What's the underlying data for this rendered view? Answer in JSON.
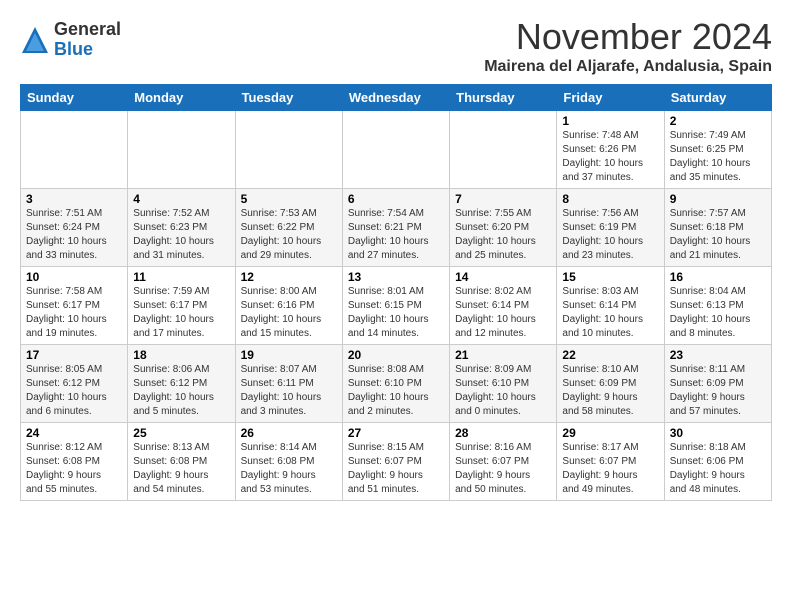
{
  "logo": {
    "general": "General",
    "blue": "Blue"
  },
  "header": {
    "title": "November 2024",
    "location": "Mairena del Aljarafe, Andalusia, Spain"
  },
  "weekdays": [
    "Sunday",
    "Monday",
    "Tuesday",
    "Wednesday",
    "Thursday",
    "Friday",
    "Saturday"
  ],
  "weeks": [
    [
      {
        "day": "",
        "detail": ""
      },
      {
        "day": "",
        "detail": ""
      },
      {
        "day": "",
        "detail": ""
      },
      {
        "day": "",
        "detail": ""
      },
      {
        "day": "",
        "detail": ""
      },
      {
        "day": "1",
        "detail": "Sunrise: 7:48 AM\nSunset: 6:26 PM\nDaylight: 10 hours\nand 37 minutes."
      },
      {
        "day": "2",
        "detail": "Sunrise: 7:49 AM\nSunset: 6:25 PM\nDaylight: 10 hours\nand 35 minutes."
      }
    ],
    [
      {
        "day": "3",
        "detail": "Sunrise: 7:51 AM\nSunset: 6:24 PM\nDaylight: 10 hours\nand 33 minutes."
      },
      {
        "day": "4",
        "detail": "Sunrise: 7:52 AM\nSunset: 6:23 PM\nDaylight: 10 hours\nand 31 minutes."
      },
      {
        "day": "5",
        "detail": "Sunrise: 7:53 AM\nSunset: 6:22 PM\nDaylight: 10 hours\nand 29 minutes."
      },
      {
        "day": "6",
        "detail": "Sunrise: 7:54 AM\nSunset: 6:21 PM\nDaylight: 10 hours\nand 27 minutes."
      },
      {
        "day": "7",
        "detail": "Sunrise: 7:55 AM\nSunset: 6:20 PM\nDaylight: 10 hours\nand 25 minutes."
      },
      {
        "day": "8",
        "detail": "Sunrise: 7:56 AM\nSunset: 6:19 PM\nDaylight: 10 hours\nand 23 minutes."
      },
      {
        "day": "9",
        "detail": "Sunrise: 7:57 AM\nSunset: 6:18 PM\nDaylight: 10 hours\nand 21 minutes."
      }
    ],
    [
      {
        "day": "10",
        "detail": "Sunrise: 7:58 AM\nSunset: 6:17 PM\nDaylight: 10 hours\nand 19 minutes."
      },
      {
        "day": "11",
        "detail": "Sunrise: 7:59 AM\nSunset: 6:17 PM\nDaylight: 10 hours\nand 17 minutes."
      },
      {
        "day": "12",
        "detail": "Sunrise: 8:00 AM\nSunset: 6:16 PM\nDaylight: 10 hours\nand 15 minutes."
      },
      {
        "day": "13",
        "detail": "Sunrise: 8:01 AM\nSunset: 6:15 PM\nDaylight: 10 hours\nand 14 minutes."
      },
      {
        "day": "14",
        "detail": "Sunrise: 8:02 AM\nSunset: 6:14 PM\nDaylight: 10 hours\nand 12 minutes."
      },
      {
        "day": "15",
        "detail": "Sunrise: 8:03 AM\nSunset: 6:14 PM\nDaylight: 10 hours\nand 10 minutes."
      },
      {
        "day": "16",
        "detail": "Sunrise: 8:04 AM\nSunset: 6:13 PM\nDaylight: 10 hours\nand 8 minutes."
      }
    ],
    [
      {
        "day": "17",
        "detail": "Sunrise: 8:05 AM\nSunset: 6:12 PM\nDaylight: 10 hours\nand 6 minutes."
      },
      {
        "day": "18",
        "detail": "Sunrise: 8:06 AM\nSunset: 6:12 PM\nDaylight: 10 hours\nand 5 minutes."
      },
      {
        "day": "19",
        "detail": "Sunrise: 8:07 AM\nSunset: 6:11 PM\nDaylight: 10 hours\nand 3 minutes."
      },
      {
        "day": "20",
        "detail": "Sunrise: 8:08 AM\nSunset: 6:10 PM\nDaylight: 10 hours\nand 2 minutes."
      },
      {
        "day": "21",
        "detail": "Sunrise: 8:09 AM\nSunset: 6:10 PM\nDaylight: 10 hours\nand 0 minutes."
      },
      {
        "day": "22",
        "detail": "Sunrise: 8:10 AM\nSunset: 6:09 PM\nDaylight: 9 hours\nand 58 minutes."
      },
      {
        "day": "23",
        "detail": "Sunrise: 8:11 AM\nSunset: 6:09 PM\nDaylight: 9 hours\nand 57 minutes."
      }
    ],
    [
      {
        "day": "24",
        "detail": "Sunrise: 8:12 AM\nSunset: 6:08 PM\nDaylight: 9 hours\nand 55 minutes."
      },
      {
        "day": "25",
        "detail": "Sunrise: 8:13 AM\nSunset: 6:08 PM\nDaylight: 9 hours\nand 54 minutes."
      },
      {
        "day": "26",
        "detail": "Sunrise: 8:14 AM\nSunset: 6:08 PM\nDaylight: 9 hours\nand 53 minutes."
      },
      {
        "day": "27",
        "detail": "Sunrise: 8:15 AM\nSunset: 6:07 PM\nDaylight: 9 hours\nand 51 minutes."
      },
      {
        "day": "28",
        "detail": "Sunrise: 8:16 AM\nSunset: 6:07 PM\nDaylight: 9 hours\nand 50 minutes."
      },
      {
        "day": "29",
        "detail": "Sunrise: 8:17 AM\nSunset: 6:07 PM\nDaylight: 9 hours\nand 49 minutes."
      },
      {
        "day": "30",
        "detail": "Sunrise: 8:18 AM\nSunset: 6:06 PM\nDaylight: 9 hours\nand 48 minutes."
      }
    ]
  ]
}
